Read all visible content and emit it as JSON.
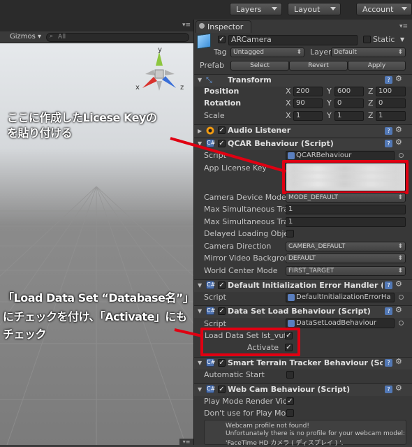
{
  "toolbar": {
    "layers": "Layers",
    "layout": "Layout",
    "account": "Account"
  },
  "scene": {
    "gizmos": "Gizmos",
    "search_placeholder": "All",
    "axis_x": "x",
    "axis_y": "y",
    "axis_z": "z"
  },
  "inspector": {
    "tab": "Inspector",
    "object_name": "ARCamera",
    "static_label": "Static",
    "tag_label": "Tag",
    "tag_value": "Untagged",
    "layer_label": "Layer",
    "layer_value": "Default",
    "prefab_label": "Prefab",
    "prefab_select": "Select",
    "prefab_revert": "Revert",
    "prefab_apply": "Apply",
    "transform": {
      "title": "Transform",
      "position_label": "Position",
      "rotation_label": "Rotation",
      "scale_label": "Scale",
      "axis_x": "X",
      "axis_y": "Y",
      "axis_z": "Z",
      "position": [
        "200",
        "600",
        "100"
      ],
      "rotation": [
        "90",
        "0",
        "0"
      ],
      "scale": [
        "1",
        "1",
        "1"
      ]
    },
    "audio_listener": {
      "title": "Audio Listener"
    },
    "qcar": {
      "title": "QCAR Behaviour (Script)",
      "script_label": "Script",
      "script_value": "QCARBehaviour",
      "license_label": "App License Key",
      "camera_mode_label": "Camera Device Mode",
      "camera_mode_value": "MODE_DEFAULT",
      "max_sim_1_label": "Max Simultaneous Tra",
      "max_sim_1_value": "1",
      "max_sim_2_label": "Max Simultaneous Tra",
      "max_sim_2_value": "1",
      "delayed_label": "Delayed Loading Obje",
      "camera_dir_label": "Camera Direction",
      "camera_dir_value": "CAMERA_DEFAULT",
      "mirror_label": "Mirror Video Backgrou",
      "mirror_value": "DEFAULT",
      "world_center_label": "World Center Mode",
      "world_center_value": "FIRST_TARGET"
    },
    "default_init": {
      "title": "Default Initialization Error Handler (Script)",
      "script_label": "Script",
      "script_value": "DefaultInitializationErrorHa"
    },
    "dataset": {
      "title": "Data Set Load Behaviour (Script)",
      "script_label": "Script",
      "script_value": "DataSetLoadBehaviour",
      "load_label": "Load Data Set lst_vufo",
      "activate_label": "Activate"
    },
    "smart_terrain": {
      "title": "Smart Terrain Tracker Behaviour (Script)",
      "auto_start_label": "Automatic Start"
    },
    "webcam": {
      "title": "Web Cam Behaviour (Script)",
      "play_mode_label": "Play Mode Render Vide",
      "dont_use_label": "Don't use for Play Moc",
      "msg1": "Webcam profile not found!",
      "msg2": "Unfortunately there is no profile for your webcam model:",
      "msg3": "'FaceTime HD カメラ ( ディスプレイ ) '."
    }
  },
  "annotations": {
    "license_line1": "ここに作成したLicese Keyの",
    "license_line2": "を貼り付ける",
    "dataset_line1": "「Load Data Set “Database名”」",
    "dataset_line2": "にチェックを付け、「Activate」にも",
    "dataset_line3": "チェック"
  },
  "colors": {
    "annotation_red": "#e00012",
    "component_blue": "#4f73b0"
  }
}
